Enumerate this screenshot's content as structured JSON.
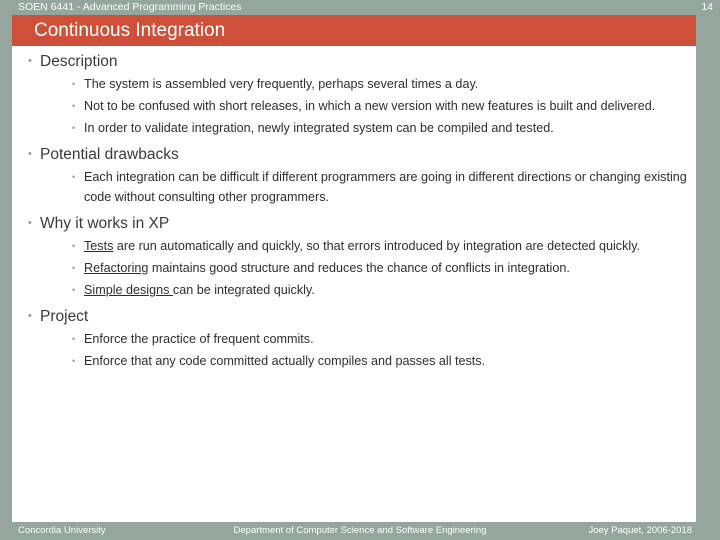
{
  "header": {
    "course": "SOEN 6441 - Advanced Programming Practices",
    "page_number": "14"
  },
  "title": "Continuous Integration",
  "colors": {
    "accent_bar": "#ce5039",
    "frame": "#94a69d",
    "background": "#ffffff",
    "body_text": "#2e2e2e"
  },
  "icons": {
    "bullet": "bullet-point-icon"
  },
  "content": [
    {
      "heading": "Description",
      "items": [
        {
          "text": "The system is assembled very frequently, perhaps several times a day."
        },
        {
          "text": "Not to be confused with short releases, in which a new version with new features is built and delivered."
        },
        {
          "text": "In order to validate integration, newly integrated system can be compiled and tested."
        }
      ]
    },
    {
      "heading": "Potential drawbacks",
      "items": [
        {
          "text": "Each integration can be difficult if different programmers are going in different directions or changing existing code without consulting other programmers."
        }
      ]
    },
    {
      "heading": "Why it works in XP",
      "items": [
        {
          "underlined": "Tests",
          "text": " are run automatically and quickly, so that errors introduced by integration are detected quickly."
        },
        {
          "underlined": "Refactoring",
          "text": " maintains good structure and reduces the chance of conflicts in integration."
        },
        {
          "underlined": "Simple designs ",
          "text": "can be integrated quickly."
        }
      ]
    },
    {
      "heading": "Project",
      "items": [
        {
          "text": "Enforce the practice of frequent commits."
        },
        {
          "text": "Enforce that any code committed actually compiles and passes all tests."
        }
      ]
    }
  ],
  "footer": {
    "left": "Concordia University",
    "center": "Department of Computer Science and Software Engineering",
    "right": "Joey Paquet, 2006-2018"
  }
}
